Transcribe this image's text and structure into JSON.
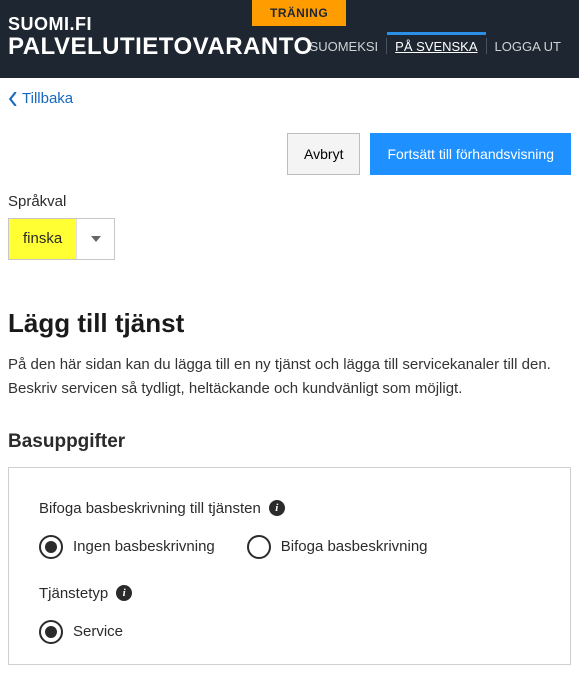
{
  "header": {
    "training_label": "TRÄNING",
    "brand_line1": "SUOMI.FI",
    "brand_line2": "PALVELUTIETOVARANTO",
    "nav": {
      "suomeksi": "SUOMEKSI",
      "svenska": "PÅ SVENSKA",
      "logout": "LOGGA UT"
    }
  },
  "back_label": "Tillbaka",
  "buttons": {
    "cancel": "Avbryt",
    "continue": "Fortsätt till förhandsvisning"
  },
  "lang_select": {
    "label": "Språkval",
    "value": "finska"
  },
  "page": {
    "title": "Lägg till tjänst",
    "intro": "På den här sidan kan du lägga till en ny tjänst och lägga till servicekanaler till den. Beskriv servicen så tydligt, heltäckande och kundvänligt som möjligt."
  },
  "section_basic": {
    "heading": "Basuppgifter",
    "attach_label": "Bifoga basbeskrivning till tjänsten",
    "radios_attach": {
      "none": "Ingen basbeskrivning",
      "attach": "Bifoga basbeskrivning"
    },
    "servicetype_label": "Tjänstetyp",
    "radios_type": {
      "service": "Service"
    }
  }
}
